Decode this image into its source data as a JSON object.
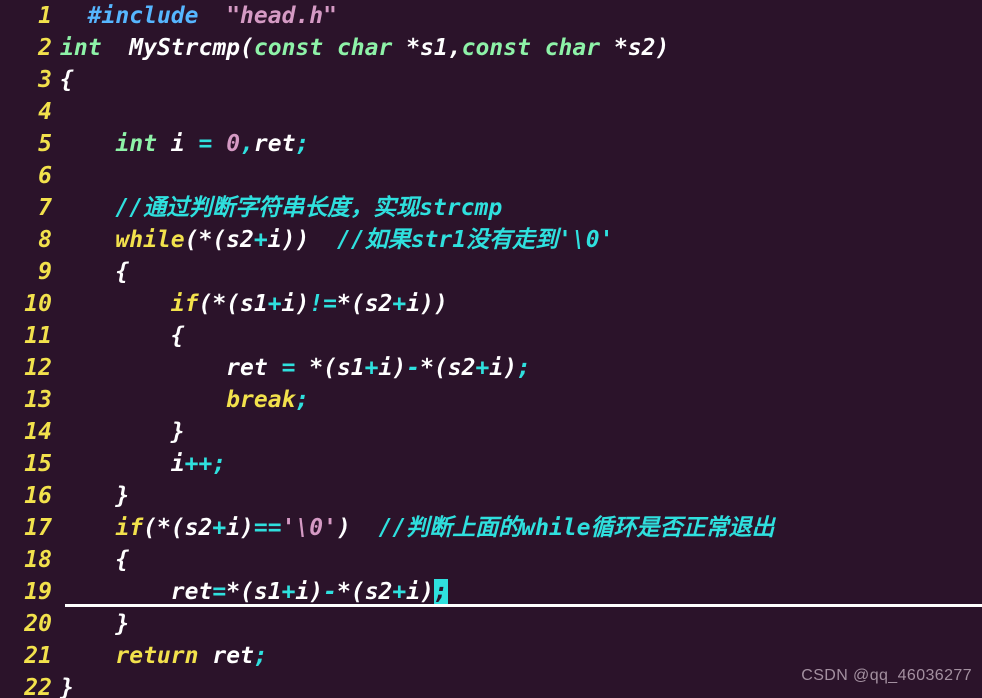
{
  "editor": {
    "background_color": "#2b132a",
    "gutter_color": "#f2e14c",
    "cursor_color": "#2fe0de",
    "cursor_line_number": 19,
    "total_lines": 22,
    "language": "C"
  },
  "watermark": {
    "text": "CSDN @qq_46036277"
  },
  "lines": [
    {
      "number": "1",
      "text": "#include \"head.h\""
    },
    {
      "number": "2",
      "text": "int  MyStrcmp(const char *s1,const char *s2)"
    },
    {
      "number": "3",
      "text": "{"
    },
    {
      "number": "4",
      "text": ""
    },
    {
      "number": "5",
      "text": "    int i = 0,ret;"
    },
    {
      "number": "6",
      "text": ""
    },
    {
      "number": "7",
      "text": "    //通过判断字符串长度，实现strcmp"
    },
    {
      "number": "8",
      "text": "    while(*(s2+i))  //如果str1没有走到'\\0'"
    },
    {
      "number": "9",
      "text": "    {"
    },
    {
      "number": "10",
      "text": "        if(*(s1+i)!=*(s2+i))"
    },
    {
      "number": "11",
      "text": "        {"
    },
    {
      "number": "12",
      "text": "            ret = *(s1+i)-*(s2+i);"
    },
    {
      "number": "13",
      "text": "            break;"
    },
    {
      "number": "14",
      "text": "        }"
    },
    {
      "number": "15",
      "text": "        i++;"
    },
    {
      "number": "16",
      "text": "    }"
    },
    {
      "number": "17",
      "text": "    if(*(s2+i)=='\\0')  //判断上面的while循环是否正常退出"
    },
    {
      "number": "18",
      "text": "    {"
    },
    {
      "number": "19",
      "text": "        ret=*(s1+i)-*(s2+i);"
    },
    {
      "number": "20",
      "text": "    }"
    },
    {
      "number": "21",
      "text": "    return ret;"
    },
    {
      "number": "22",
      "text": "}"
    }
  ],
  "tokens": {
    "l1": [
      [
        "  ",
        "plain"
      ],
      [
        "#include",
        "pre"
      ],
      [
        "  ",
        "plain"
      ],
      [
        "\"head.h\"",
        "str"
      ]
    ],
    "l2": [
      [
        "int",
        "type"
      ],
      [
        "  ",
        "plain"
      ],
      [
        "MyStrcmp(",
        "plain"
      ],
      [
        "const char",
        "type"
      ],
      [
        " *s1,",
        "plain"
      ],
      [
        "const char",
        "type"
      ],
      [
        " *s2)",
        "plain"
      ]
    ],
    "l3": [
      [
        "{",
        "plain"
      ]
    ],
    "l5": [
      [
        "    ",
        "plain"
      ],
      [
        "int",
        "type"
      ],
      [
        " i ",
        "plain"
      ],
      [
        "=",
        "op"
      ],
      [
        " ",
        "plain"
      ],
      [
        "0",
        "str"
      ],
      [
        ",",
        "op"
      ],
      [
        "ret",
        "plain"
      ],
      [
        ";",
        "op"
      ]
    ],
    "l7": [
      [
        "    ",
        "plain"
      ],
      [
        "//通过判断字符串长度，实现strcmp",
        "cmt"
      ]
    ],
    "l8": [
      [
        "    ",
        "plain"
      ],
      [
        "while",
        "key"
      ],
      [
        "(*(s2",
        "plain"
      ],
      [
        "+",
        "op"
      ],
      [
        "i))",
        "plain"
      ],
      [
        "  ",
        "plain"
      ],
      [
        "//如果str1没有走到'\\0'",
        "cmt"
      ]
    ],
    "l9": [
      [
        "    ",
        "plain"
      ],
      [
        "{",
        "plain"
      ]
    ],
    "l10": [
      [
        "        ",
        "plain"
      ],
      [
        "if",
        "key"
      ],
      [
        "(*(s1",
        "plain"
      ],
      [
        "+",
        "op"
      ],
      [
        "i)",
        "plain"
      ],
      [
        "!=",
        "op"
      ],
      [
        "*(s2",
        "plain"
      ],
      [
        "+",
        "op"
      ],
      [
        "i))",
        "plain"
      ]
    ],
    "l11": [
      [
        "        ",
        "plain"
      ],
      [
        "{",
        "plain"
      ]
    ],
    "l12": [
      [
        "            ",
        "plain"
      ],
      [
        "ret ",
        "plain"
      ],
      [
        "=",
        "op"
      ],
      [
        " *(s1",
        "plain"
      ],
      [
        "+",
        "op"
      ],
      [
        "i)",
        "plain"
      ],
      [
        "-",
        "op"
      ],
      [
        "*(s2",
        "plain"
      ],
      [
        "+",
        "op"
      ],
      [
        "i)",
        "plain"
      ],
      [
        ";",
        "op"
      ]
    ],
    "l13": [
      [
        "            ",
        "plain"
      ],
      [
        "break",
        "key"
      ],
      [
        ";",
        "op"
      ]
    ],
    "l14": [
      [
        "        ",
        "plain"
      ],
      [
        "}",
        "plain"
      ]
    ],
    "l15": [
      [
        "        ",
        "plain"
      ],
      [
        "i",
        "plain"
      ],
      [
        "++",
        "op"
      ],
      [
        ";",
        "op"
      ]
    ],
    "l16": [
      [
        "    ",
        "plain"
      ],
      [
        "}",
        "plain"
      ]
    ],
    "l17": [
      [
        "    ",
        "plain"
      ],
      [
        "if",
        "key"
      ],
      [
        "(*(s2",
        "plain"
      ],
      [
        "+",
        "op"
      ],
      [
        "i)",
        "plain"
      ],
      [
        "==",
        "op"
      ],
      [
        "'\\0'",
        "str"
      ],
      [
        ")",
        "plain"
      ],
      [
        "  ",
        "plain"
      ],
      [
        "//判断上面的while循环是否正常退出",
        "cmt"
      ]
    ],
    "l18": [
      [
        "    ",
        "plain"
      ],
      [
        "{",
        "plain"
      ]
    ],
    "l19": [
      [
        "        ",
        "plain"
      ],
      [
        "ret",
        "plain"
      ],
      [
        "=",
        "op"
      ],
      [
        "*(s1",
        "plain"
      ],
      [
        "+",
        "op"
      ],
      [
        "i)",
        "plain"
      ],
      [
        "-",
        "op"
      ],
      [
        "*(s2",
        "plain"
      ],
      [
        "+",
        "op"
      ],
      [
        "i)",
        "plain"
      ]
    ],
    "l19cursor": ";",
    "l20": [
      [
        "    ",
        "plain"
      ],
      [
        "}",
        "plain"
      ]
    ],
    "l21": [
      [
        "    ",
        "plain"
      ],
      [
        "return",
        "key"
      ],
      [
        " ",
        "plain"
      ],
      [
        "ret",
        "plain"
      ],
      [
        ";",
        "op"
      ]
    ],
    "l22": [
      [
        "}",
        "plain"
      ]
    ]
  }
}
